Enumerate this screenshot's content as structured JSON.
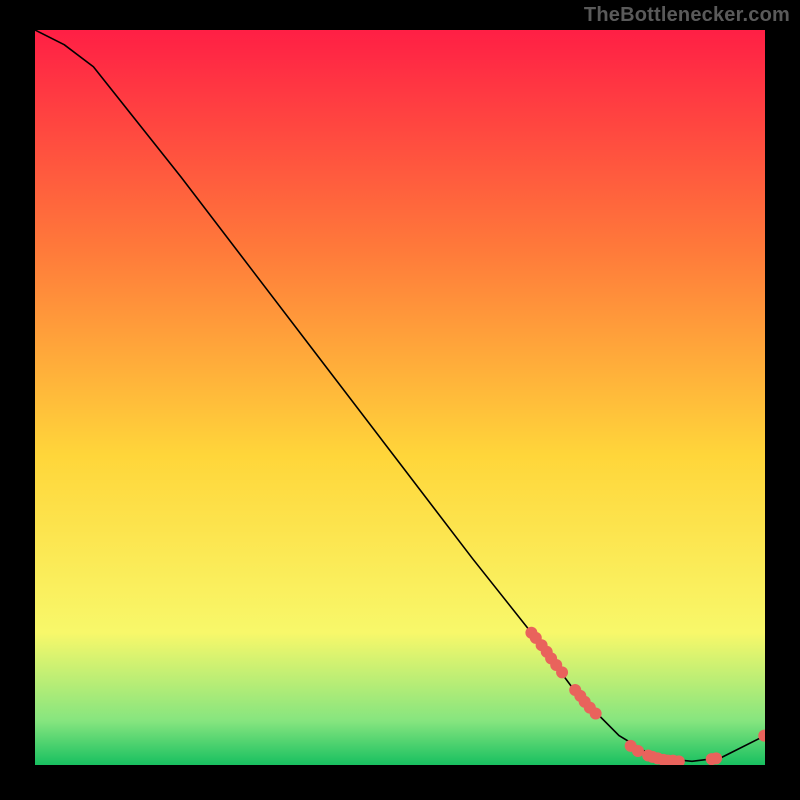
{
  "watermark": "TheBottlenecker.com",
  "colors": {
    "bg": "#000000",
    "line": "#000000",
    "dot": "#e9635c",
    "grad_top": "#ff1f45",
    "grad_mid1": "#ff7a3a",
    "grad_mid2": "#ffd63a",
    "grad_low1": "#f8f86a",
    "grad_low2": "#86e57f",
    "grad_bottom": "#18c060"
  },
  "chart_data": {
    "type": "line",
    "title": "",
    "xlabel": "",
    "ylabel": "",
    "xlim": [
      0,
      100
    ],
    "ylim": [
      0,
      100
    ],
    "curve": [
      {
        "x": 0,
        "y": 100
      },
      {
        "x": 4,
        "y": 98
      },
      {
        "x": 8,
        "y": 95
      },
      {
        "x": 12,
        "y": 90
      },
      {
        "x": 20,
        "y": 80
      },
      {
        "x": 30,
        "y": 67
      },
      {
        "x": 40,
        "y": 54
      },
      {
        "x": 50,
        "y": 41
      },
      {
        "x": 60,
        "y": 28
      },
      {
        "x": 68,
        "y": 18
      },
      {
        "x": 74,
        "y": 10
      },
      {
        "x": 80,
        "y": 4
      },
      {
        "x": 85,
        "y": 1
      },
      {
        "x": 90,
        "y": 0.5
      },
      {
        "x": 94,
        "y": 1
      },
      {
        "x": 100,
        "y": 4
      }
    ],
    "dots": [
      {
        "x": 68.0,
        "y": 18.0
      },
      {
        "x": 68.6,
        "y": 17.3
      },
      {
        "x": 69.4,
        "y": 16.3
      },
      {
        "x": 70.1,
        "y": 15.4
      },
      {
        "x": 70.7,
        "y": 14.5
      },
      {
        "x": 71.4,
        "y": 13.6
      },
      {
        "x": 72.2,
        "y": 12.6
      },
      {
        "x": 74.0,
        "y": 10.2
      },
      {
        "x": 74.7,
        "y": 9.4
      },
      {
        "x": 75.3,
        "y": 8.6
      },
      {
        "x": 76.0,
        "y": 7.8
      },
      {
        "x": 76.8,
        "y": 7.0
      },
      {
        "x": 81.6,
        "y": 2.6
      },
      {
        "x": 82.6,
        "y": 1.9
      },
      {
        "x": 84.0,
        "y": 1.3
      },
      {
        "x": 84.6,
        "y": 1.1
      },
      {
        "x": 85.3,
        "y": 0.9
      },
      {
        "x": 86.1,
        "y": 0.7
      },
      {
        "x": 86.7,
        "y": 0.6
      },
      {
        "x": 87.4,
        "y": 0.6
      },
      {
        "x": 88.2,
        "y": 0.5
      },
      {
        "x": 92.7,
        "y": 0.8
      },
      {
        "x": 93.3,
        "y": 0.9
      },
      {
        "x": 99.9,
        "y": 4.0
      }
    ]
  }
}
